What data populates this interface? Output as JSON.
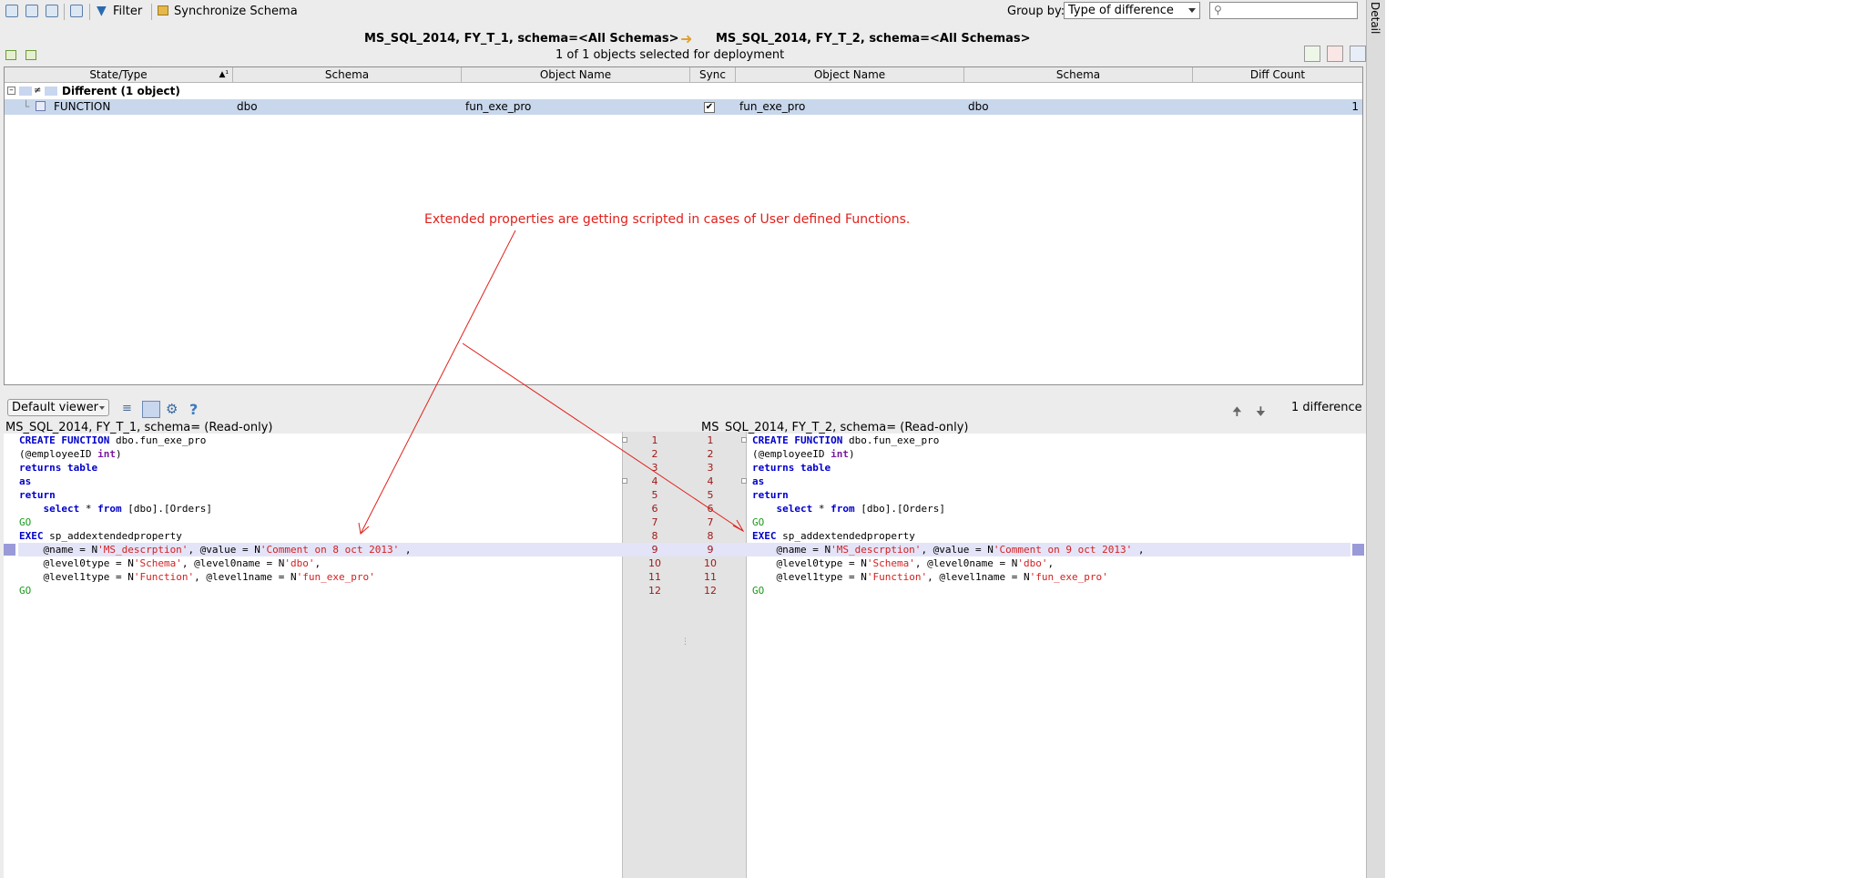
{
  "toolbar": {
    "filter_label": "Filter",
    "sync_label": "Synchronize Schema",
    "group_by_label": "Group by:",
    "group_by_value": "Type of difference",
    "search_placeholder": ""
  },
  "detail_label": "Detail",
  "compare": {
    "left_header": "MS_SQL_2014, FY_T_1,  schema=<All Schemas>",
    "right_header": "MS_SQL_2014, FY_T_2,  schema=<All Schemas>",
    "selection_status": "1 of 1 objects selected for deployment"
  },
  "grid": {
    "columns": [
      "State/Type",
      "Schema",
      "Object Name",
      "Sync",
      "Object Name",
      "Schema",
      "Diff Count"
    ],
    "sort_indicator": "▲¹",
    "group_row": "Different (1 object)",
    "rows": [
      {
        "type": "FUNCTION",
        "schema_left": "dbo",
        "name_left": "fun_exe_pro",
        "sync": "✔",
        "name_right": "fun_exe_pro",
        "schema_right": "dbo",
        "diff_count": "1"
      }
    ]
  },
  "annotation": "Extended properties are getting scripted in cases of User defined Functions.",
  "viewer": {
    "viewer_select": "Default viewer",
    "difference_count": "1 difference",
    "help": "?",
    "left_title": "MS_SQL_2014, FY_T_1, schema= (Read-only)",
    "right_title": "MS_SQL_2014, FY_T_2, schema= (Read-only)"
  },
  "code_left": [
    "CREATE FUNCTION dbo.fun_exe_pro",
    "(@employeeID int)",
    "returns table",
    "as",
    "return",
    "    select * from [dbo].[Orders]",
    "GO",
    "EXEC sp_addextendedproperty",
    "    @name = N'MS_descrption', @value = N'Comment on 8 oct 2013' ,",
    "    @level0type = N'Schema', @level0name = N'dbo',",
    "    @level1type = N'Function', @level1name = N'fun_exe_pro'",
    "GO"
  ],
  "code_right": [
    "CREATE FUNCTION dbo.fun_exe_pro",
    "(@employeeID int)",
    "returns table",
    "as",
    "return",
    "    select * from [dbo].[Orders]",
    "GO",
    "EXEC sp_addextendedproperty",
    "    @name = N'MS_descrption', @value = N'Comment on 9 oct 2013' ,",
    "    @level0type = N'Schema', @level0name = N'dbo',",
    "    @level1type = N'Function', @level1name = N'fun_exe_pro'",
    "GO"
  ],
  "line_numbers": [
    "1",
    "2",
    "3",
    "4",
    "5",
    "6",
    "7",
    "8",
    "9",
    "10",
    "11",
    "12"
  ],
  "code_tokens": {
    "create": "CREATE",
    "function": "FUNCTION",
    "fn_name": " dbo.fun_exe_pro",
    "param_open": "(@employeeID ",
    "int": "int",
    "param_close": ")",
    "returns": "returns",
    "table": "table",
    "as": "as",
    "return": "return",
    "indent": "    ",
    "select": "select",
    "star": " * ",
    "from": "from",
    "orders": " [dbo].[Orders]",
    "go": "GO",
    "exec": "EXEC",
    "proc": " sp_addextendedproperty",
    "name_eq": "    @name = N",
    "ms_descr": "'MS_descrption'",
    "value_eq": ", @value = N",
    "comment_left": "'Comment on 8 oct 2013'",
    "comment_right": "'Comment on 9 oct 2013'",
    "tail": " ,",
    "l0type": "    @level0type = N",
    "schema": "'Schema'",
    "l0name": ", @level0name = N",
    "dbo": "'dbo'",
    "comma": ",",
    "l1type": "    @level1type = N",
    "function_str": "'Function'",
    "l1name": ", @level1name = N",
    "fnstr": "'fun_exe_pro'"
  }
}
